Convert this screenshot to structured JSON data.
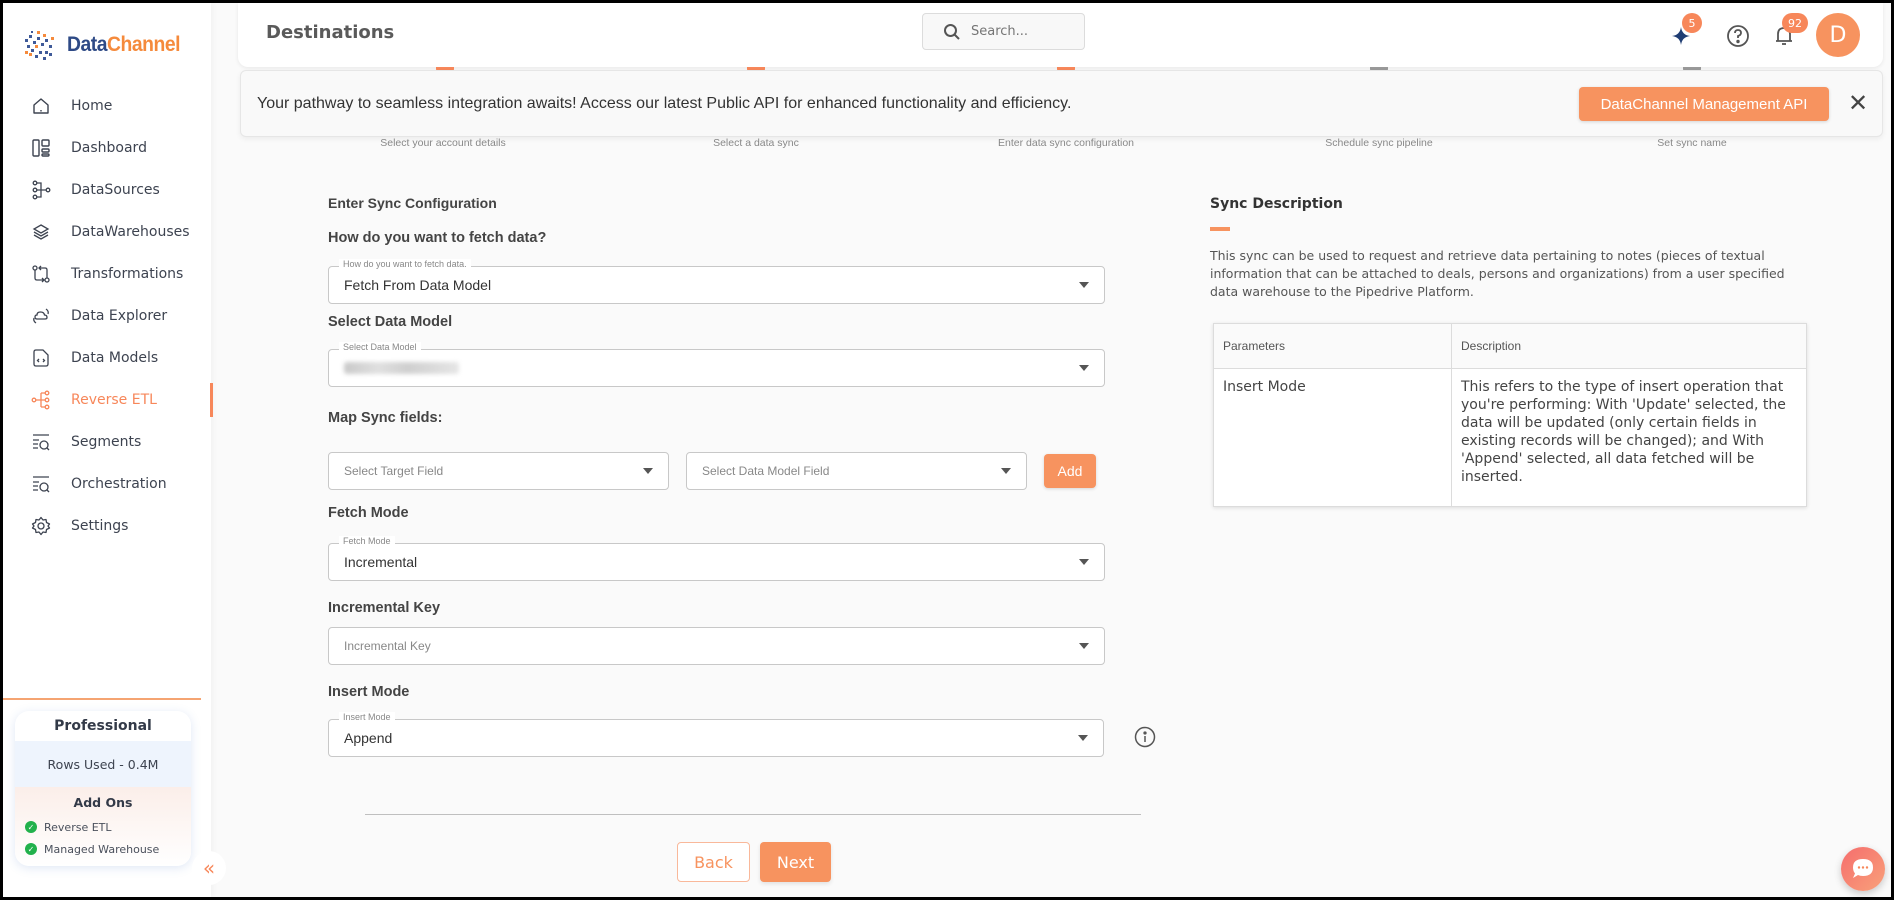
{
  "brand": {
    "name_part1": "Data",
    "name_part2": "Channel",
    "colors": {
      "accent": "#f7935f",
      "brand_blue": "#2e4a86",
      "brand_orange": "#f58a3c"
    }
  },
  "sidebar": {
    "items": [
      {
        "label": "Home",
        "icon": "home-icon",
        "active": false
      },
      {
        "label": "Dashboard",
        "icon": "dashboard-icon",
        "active": false
      },
      {
        "label": "DataSources",
        "icon": "datasources-icon",
        "active": false
      },
      {
        "label": "DataWarehouses",
        "icon": "layers-icon",
        "active": false
      },
      {
        "label": "Transformations",
        "icon": "transform-icon",
        "active": false
      },
      {
        "label": "Data Explorer",
        "icon": "cloud-sync-icon",
        "active": false
      },
      {
        "label": "Data Models",
        "icon": "code-file-icon",
        "active": false
      },
      {
        "label": "Reverse ETL",
        "icon": "reverse-etl-icon",
        "active": true
      },
      {
        "label": "Segments",
        "icon": "segments-icon",
        "active": false
      },
      {
        "label": "Orchestration",
        "icon": "orchestration-icon",
        "active": false
      },
      {
        "label": "Settings",
        "icon": "gear-icon",
        "active": false
      }
    ],
    "plan": {
      "title": "Professional",
      "rows_used": "Rows Used - 0.4M",
      "addons_title": "Add Ons",
      "addons": [
        "Reverse ETL",
        "Managed Warehouse"
      ]
    }
  },
  "header": {
    "title": "Destinations",
    "search_placeholder": "Search...",
    "sparkle_badge": "5",
    "notification_badge": "92",
    "avatar_initial": "D"
  },
  "banner": {
    "text": "Your pathway to seamless integration awaits! Access our latest Public API for enhanced functionality and efficiency.",
    "button_label": "DataChannel Management API",
    "close_label": "✕"
  },
  "steps": [
    {
      "label": "Select your account details",
      "state": "done"
    },
    {
      "label": "Select a data sync",
      "state": "done"
    },
    {
      "label": "Enter data sync configuration",
      "state": "current"
    },
    {
      "label": "Schedule sync pipeline",
      "state": "pending"
    },
    {
      "label": "Set sync name",
      "state": "pending"
    }
  ],
  "form": {
    "section_title": "Enter Sync Configuration",
    "fetch_data": {
      "label": "How do you want to fetch data?",
      "legend": "How do you want to fetch data.",
      "value": "Fetch From Data Model"
    },
    "data_model": {
      "label": "Select Data Model",
      "legend": "Select Data Model",
      "value_blurred": true
    },
    "map_fields": {
      "label": "Map Sync fields:",
      "target_placeholder": "Select Target Field",
      "model_placeholder": "Select Data Model Field",
      "add_label": "Add"
    },
    "fetch_mode": {
      "label": "Fetch Mode",
      "legend": "Fetch Mode",
      "value": "Incremental"
    },
    "incremental_key": {
      "label": "Incremental Key",
      "placeholder": "Incremental Key"
    },
    "insert_mode": {
      "label": "Insert Mode",
      "legend": "Insert Mode",
      "value": "Append"
    },
    "back_label": "Back",
    "next_label": "Next"
  },
  "description": {
    "title": "Sync Description",
    "text": "This sync can be used to request and retrieve data pertaining to notes (pieces of textual information that can be attached to deals, persons and organizations) from a user specified data warehouse to the Pipedrive Platform.",
    "table": {
      "headers": [
        "Parameters",
        "Description"
      ],
      "rows": [
        [
          "Insert Mode",
          "This refers to the type of insert operation that you're performing: With 'Update' selected, the data will be updated (only certain fields in existing records will be changed); and With 'Append' selected, all data fetched will be inserted."
        ]
      ]
    }
  }
}
